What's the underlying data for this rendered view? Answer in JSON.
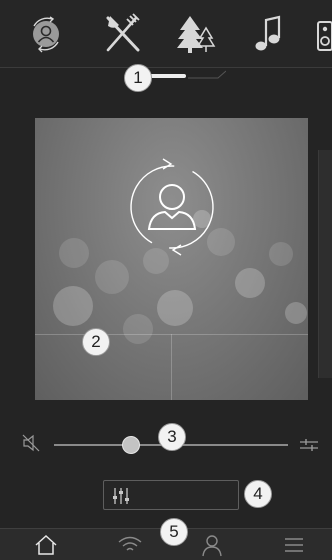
{
  "top_nav": {
    "items": [
      {
        "name": "profile-switch",
        "icon": "profile-switch-icon"
      },
      {
        "name": "restaurants",
        "icon": "fork-knife-icon"
      },
      {
        "name": "nature",
        "icon": "trees-icon"
      },
      {
        "name": "music",
        "icon": "music-note-icon"
      },
      {
        "name": "speaker",
        "icon": "speaker-icon"
      }
    ]
  },
  "callouts": {
    "c1": "1",
    "c2": "2",
    "c3": "3",
    "c4": "4",
    "c5": "5"
  },
  "volume": {
    "level_fraction": 0.33,
    "mute_icon": "speaker-muted-icon",
    "eq_icon": "equalizer-icon"
  },
  "settings_button": {
    "icon": "sliders-icon"
  },
  "bottom_nav": {
    "items": [
      {
        "name": "home",
        "icon": "home-icon"
      },
      {
        "name": "wifi",
        "icon": "wifi-icon"
      },
      {
        "name": "profile",
        "icon": "person-icon"
      },
      {
        "name": "menu",
        "icon": "menu-icon"
      }
    ]
  },
  "colors": {
    "background": "#1f1f1f",
    "topbar": "#262626",
    "icon": "#d8d8d8",
    "callout_fill": "#f2f2f2"
  }
}
